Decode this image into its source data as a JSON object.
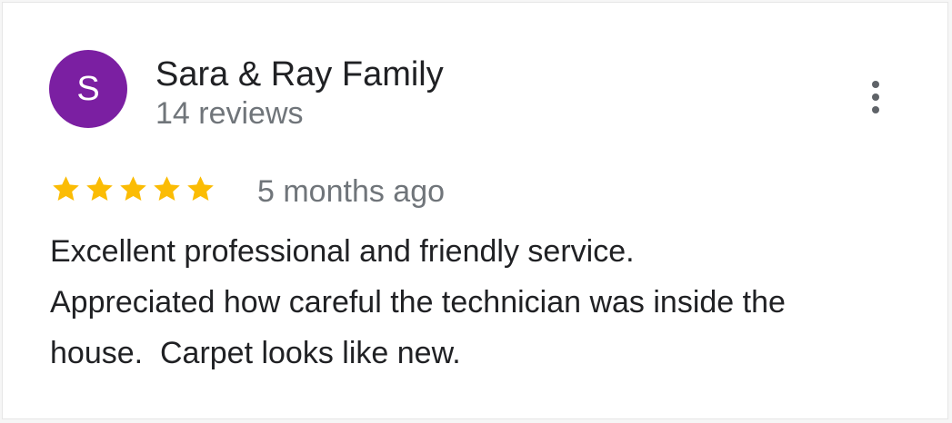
{
  "reviewer": {
    "initial": "S",
    "avatar_color": "#7b1fa2",
    "name": "Sara & Ray Family",
    "reviews_count": "14 reviews"
  },
  "menu": {
    "icon": "more-vert-icon"
  },
  "rating": {
    "stars": 5,
    "max_stars": 5,
    "star_color": "#fbbc04",
    "star_icon": "star-icon"
  },
  "review": {
    "time": "5 months ago",
    "lines": [
      "Excellent professional and friendly service.",
      "Appreciated how careful the technician was inside the",
      "house.  Carpet looks like new."
    ]
  }
}
